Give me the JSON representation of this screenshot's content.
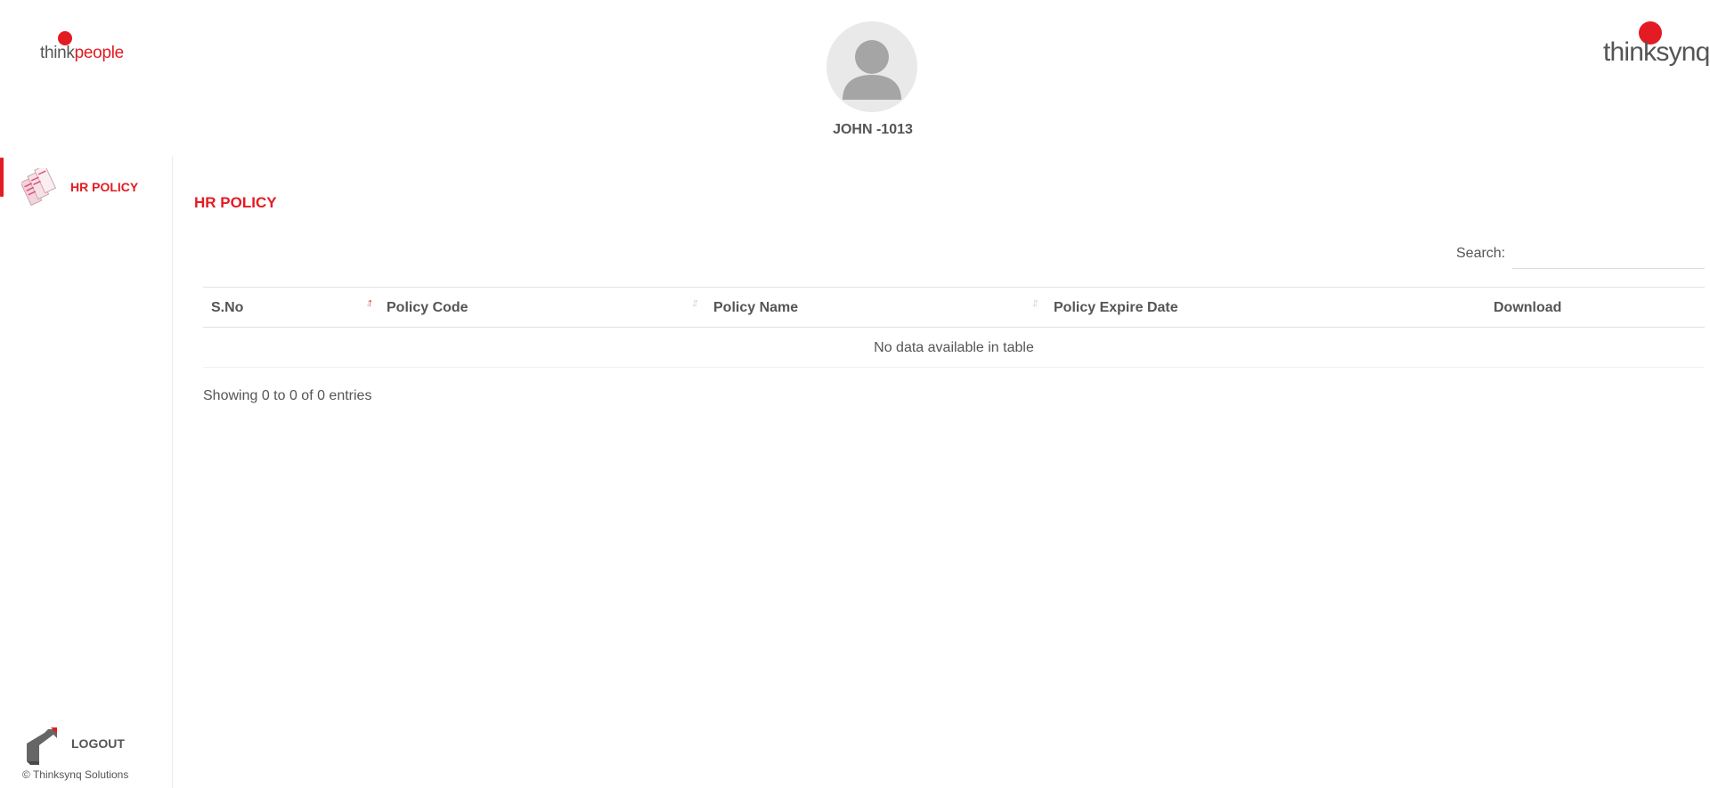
{
  "header": {
    "left_logo": {
      "part1": "think",
      "part2": "people"
    },
    "right_logo": {
      "text": "thinksynq"
    },
    "user_name": "JOHN -1013"
  },
  "sidebar": {
    "items": [
      {
        "label": "HR POLICY",
        "icon": "policy-documents-icon",
        "active": true
      }
    ],
    "logout_label": "LOGOUT",
    "copyright": "© Thinksynq Solutions"
  },
  "main": {
    "page_title": "HR POLICY",
    "search": {
      "label": "Search:",
      "value": "",
      "placeholder": ""
    },
    "table": {
      "columns": [
        "S.No",
        "Policy Code",
        "Policy Name",
        "Policy Expire Date",
        "Download"
      ],
      "empty_message": "No data available in table"
    },
    "info": "Showing 0 to 0 of 0 entries"
  },
  "colors": {
    "accent": "#e31b23",
    "text": "#555555",
    "border": "#e1e1e1"
  }
}
